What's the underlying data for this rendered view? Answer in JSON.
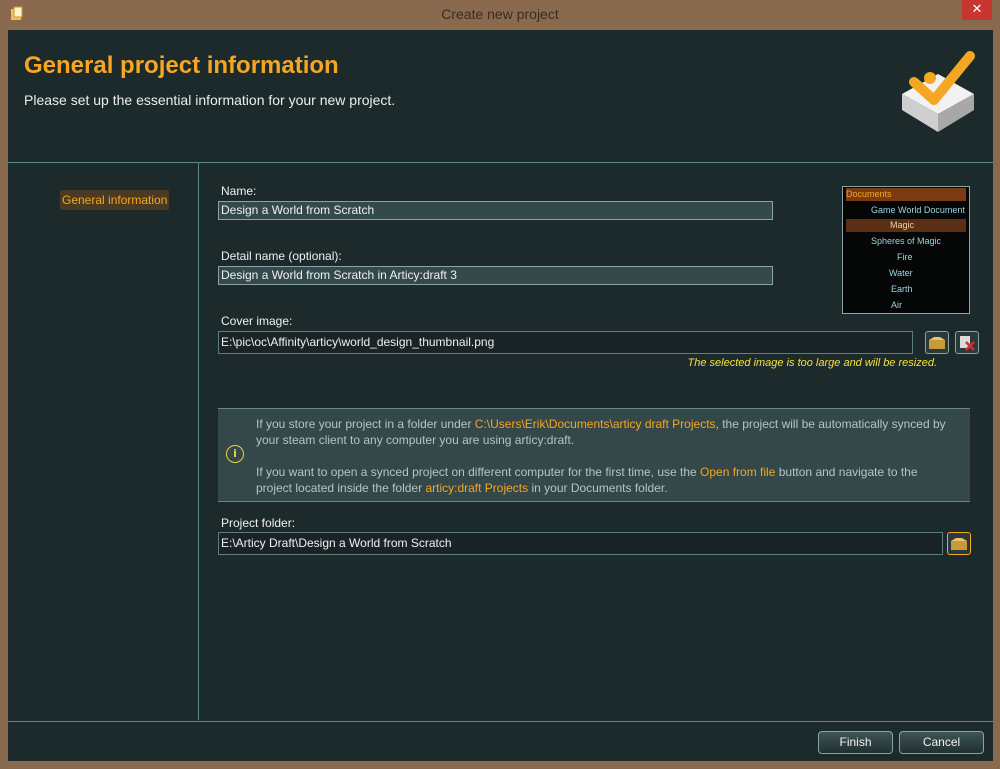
{
  "window": {
    "title": "Create new project",
    "close_label": "✕"
  },
  "header": {
    "title": "General project information",
    "subtitle": "Please set up the essential information for your new project."
  },
  "sidebar": {
    "items": [
      {
        "label": "General information",
        "active": true
      }
    ]
  },
  "form": {
    "name_label": "Name:",
    "name_value": "Design a World from Scratch",
    "detail_label": "Detail name (optional):",
    "detail_value": "Design a World from Scratch in Articy:draft 3",
    "cover_label": "Cover image:",
    "cover_value": "E:\\pic\\oc\\Affinity\\articy\\world_design_thumbnail.png",
    "cover_warning": "The selected image is too large and will be resized.",
    "folder_label": "Project folder:",
    "folder_value": "E:\\Articy Draft\\Design a World from Scratch"
  },
  "info": {
    "p1_a": "If you store your project in a folder under ",
    "p1_path": "C:\\Users\\Erik\\Documents\\articy draft Projects",
    "p1_b": ", the project will be automatically synced by your steam client to any computer you are using articy:draft.",
    "p2_a": "If you want to open a synced project on different computer for the first time, use the ",
    "p2_btn": "Open from file",
    "p2_b": " button and navigate to the project located inside the folder ",
    "p2_folder": "articy:draft Projects",
    "p2_c": " in your Documents folder."
  },
  "thumbnail": {
    "rows": [
      "Documents",
      "Game World Document",
      "Magic",
      "Spheres of Magic",
      "Fire",
      "Water",
      "Earth",
      "Air"
    ]
  },
  "footer": {
    "finish_label": "Finish",
    "cancel_label": "Cancel"
  },
  "colors": {
    "accent": "#f5a623",
    "background": "#1d2a2c",
    "frame": "#8a6a4e",
    "warning": "#f3e23a"
  }
}
